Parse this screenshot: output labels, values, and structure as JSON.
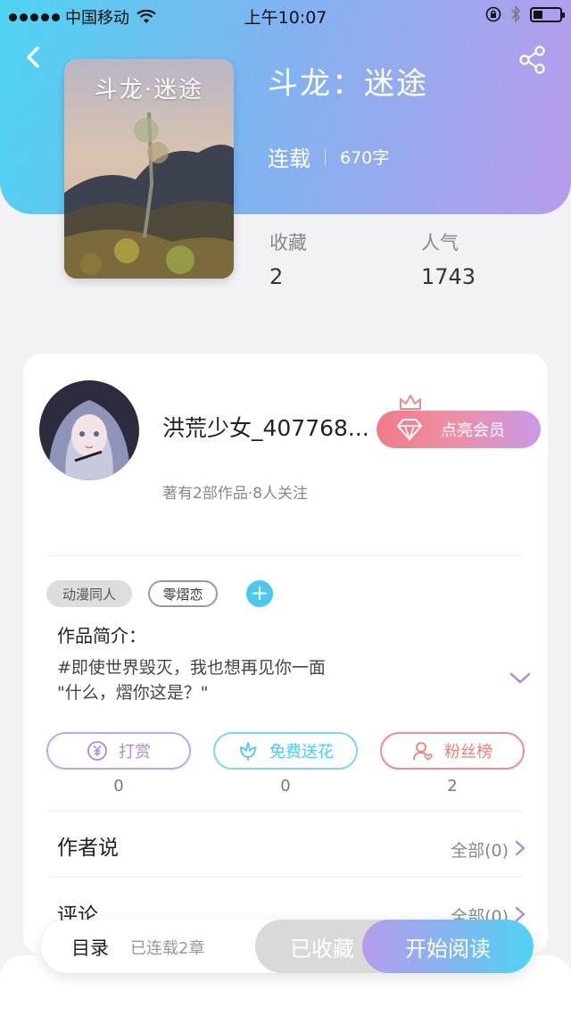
{
  "status_bar": {
    "carrier": "中国移动",
    "time": "上午10:07",
    "battery_level": 0.35
  },
  "book": {
    "cover_title": "斗龙·迷途",
    "title": "斗龙：迷途",
    "status": "连载",
    "word_count": "670字",
    "stats": [
      {
        "label": "收藏",
        "value": "2"
      },
      {
        "label": "人气",
        "value": "1743"
      }
    ]
  },
  "author": {
    "name": "洪荒少女_407768...",
    "meta": "著有2部作品·8人关注",
    "vip_label": "点亮会员"
  },
  "tags": [
    "动漫同人",
    "零熠恋"
  ],
  "intro": {
    "title": "作品简介：",
    "lines": [
      "#即使世界毁灭，我也想再见你一面",
      "\"什么，熠你这是？\""
    ]
  },
  "actions": [
    {
      "label": "打赏",
      "count": "0",
      "icon": "yen-icon"
    },
    {
      "label": "免费送花",
      "count": "0",
      "icon": "flower-icon"
    },
    {
      "label": "粉丝榜",
      "count": "2",
      "icon": "fan-ranking-icon"
    }
  ],
  "sections": [
    {
      "title": "作者说",
      "all": "全部(0)"
    },
    {
      "title": "评论",
      "all": "全部(0)"
    }
  ],
  "bottom_bar": {
    "catalog": "目录",
    "chapters": "已连载2章",
    "collected": "已收藏",
    "start_reading": "开始阅读"
  },
  "colors": {
    "header_start": "#4fd3f2",
    "header_end": "#b89cec",
    "accent_cyan": "#4ec9ee",
    "accent_purple": "#b08ad8",
    "accent_red": "#ee7e7e"
  }
}
